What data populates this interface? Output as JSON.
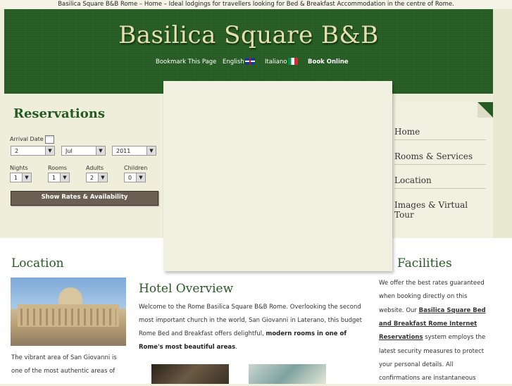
{
  "top_tagline": "Basilica Square B&B Rome – Home – Ideal lodgings for travellers looking for Bed & Breakfast Accommodation in the centre of Rome.",
  "header": {
    "logo": "Basilica Square B&B",
    "nav": {
      "bookmark": "Bookmark This Page",
      "english": "English",
      "italiano": "Italiano",
      "book_online": "Book Online"
    }
  },
  "reservations": {
    "title": "Reservations",
    "arrival_label": "Arrival Date",
    "day": "2",
    "month": "Jul",
    "year": "2011",
    "nights_label": "Nights",
    "nights": "1",
    "rooms_label": "Rooms",
    "rooms": "1",
    "adults_label": "Adults",
    "adults": "2",
    "children_label": "Children",
    "children": "0",
    "button": "Show Rates & Availability"
  },
  "menu": {
    "home": "Home",
    "rooms": "Rooms & Services",
    "location": "Location",
    "images": "Images & Virtual Tour"
  },
  "location": {
    "title": "Location",
    "line1": "The vibrant area of San Giovanni is",
    "line2": "one of the most authentic areas of"
  },
  "overview": {
    "title": "Hotel Overview",
    "line1": "Welcome to the Rome Basilica Square B&B Rome. Overlooking the second",
    "line2": "most important church in the world, San Giovanni in Laterano, this budget",
    "line3a": "Rome Bed and Breakfast offers delightful, ",
    "line3b": "modern rooms in one of",
    "line4a": "Rome's most beautiful areas",
    "line4b": "."
  },
  "facilities": {
    "title": "Facilities",
    "line1": "We offer the best rates guaranteed",
    "line2": "when booking directly on this",
    "line3a": "website. Our ",
    "line3b": "Basilica Square Bed",
    "line4": "and Breakfast Rome Internet",
    "line5a": "Reservations",
    "line5b": " system employs the",
    "line6": "latest security measures to protect",
    "line7": "your personal details. All",
    "line8": "confirmations are instantaneous"
  },
  "colors": {
    "brand_green": "#255b22",
    "button_brown": "#6b5e52"
  }
}
